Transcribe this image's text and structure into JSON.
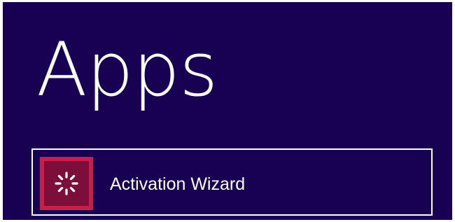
{
  "page": {
    "heading": "Apps"
  },
  "apps": [
    {
      "label": "Activation Wizard",
      "icon": "activation-spinner-icon",
      "tile_color": "#c71f4a",
      "icon_bg_color": "#7c0f39"
    }
  ],
  "colors": {
    "background": "#180052",
    "text": "#ffffff"
  }
}
